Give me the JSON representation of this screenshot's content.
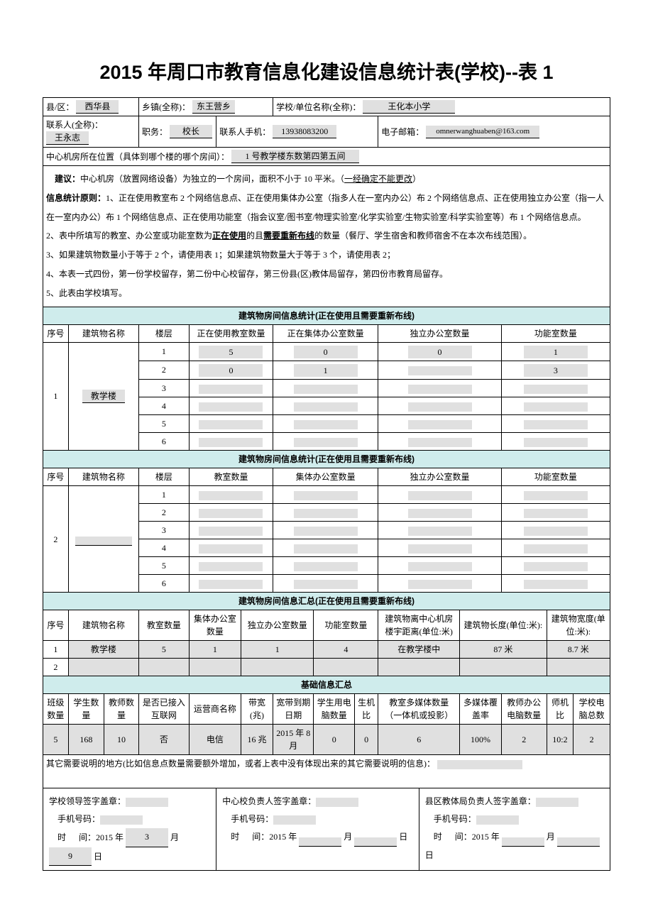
{
  "title": "2015 年周口市教育信息化建设信息统计表(学校)--表 1",
  "header": {
    "county_label": "县/区：",
    "county": "西华县",
    "township_label": "乡镇(全称)：",
    "township": "东王营乡",
    "school_label": "学校/单位名称(全称)：",
    "school": "王化本小学",
    "contact_label": "联系人(全称)：",
    "contact": "王永志",
    "position_label": "职务：",
    "position": "校长",
    "phone_label": "联系人手机：",
    "phone": "13938083200",
    "email_label": "电子邮箱：",
    "email": "omnerwanghuaben@163.com",
    "server_room_label": "中心机房所在位置（具体到哪个楼的哪个房间）：",
    "server_room": "1 号教学楼东数第四第五间"
  },
  "suggest": {
    "label": "建议：",
    "text": "中心机房（放置网络设备）为独立的一个房间，面积不小于 10 平米。（",
    "fixed": "一经确定不能更改",
    "tail": "）"
  },
  "rules": {
    "r1a": "信息统计原则：",
    "r1b": "1、正在使用教室布 2 个网络信息点、正在使用集体办公室（指多人在一室内办公）布 2 个网络信息点、正在使用独立办公室（指一人",
    "r1c": "在一室内办公）布 1 个网络信息点、正在使用功能室（指会议室/图书室/物理实验室/化学实验室/生物实验室/科学实验室等）布 1 个网络信息点。",
    "r2a": "2、表中所填写的教室、办公室或功能室数为",
    "r2b": "正在使用",
    "r2c": "的且",
    "r2d": "需要重新布线",
    "r2e": "的数量（餐厅、学生宿舍和教师宿舍不在本次布线范围）。",
    "r3": "3、如果建筑物数量小于等于 2 个，请使用表 1；如果建筑物数量大于等于 3 个，请使用表 2；",
    "r4": "4、本表一式四份，第一份学校留存，第二份中心校留存，第三份县(区)教体局留存，第四份市教育局留存。",
    "r5": "5、此表由学校填写。"
  },
  "bldg1": {
    "section": "建筑物房间信息统计(正在使用且需要重新布线)",
    "cols": {
      "seq": "序号",
      "name": "建筑物名称",
      "floor": "楼层",
      "classrooms": "正在使用教室数量",
      "group": "正在集体办公室数量",
      "indep": "独立办公室数量",
      "func": "功能室数量"
    },
    "rows": [
      {
        "seq": "1",
        "name": "教学楼",
        "floors": [
          {
            "f": "1",
            "c": "5",
            "g": "0",
            "i": "0",
            "fn": "1"
          },
          {
            "f": "2",
            "c": "0",
            "g": "1",
            "i": "",
            "fn": "3"
          },
          {
            "f": "3",
            "c": "",
            "g": "",
            "i": "",
            "fn": ""
          },
          {
            "f": "4",
            "c": "",
            "g": "",
            "i": "",
            "fn": ""
          },
          {
            "f": "5",
            "c": "",
            "g": "",
            "i": "",
            "fn": ""
          },
          {
            "f": "6",
            "c": "",
            "g": "",
            "i": "",
            "fn": ""
          }
        ]
      }
    ]
  },
  "bldg2": {
    "section": "建筑物房间信息统计(正在使用且需要重新布线)",
    "cols": {
      "seq": "序号",
      "name": "建筑物名称",
      "floor": "楼层",
      "classrooms": "教室数量",
      "group": "集体办公室数量",
      "indep": "独立办公室数量",
      "func": "功能室数量"
    },
    "rows": [
      {
        "seq": "2",
        "name": "",
        "floors": [
          {
            "f": "1",
            "c": "",
            "g": "",
            "i": "",
            "fn": ""
          },
          {
            "f": "2",
            "c": "",
            "g": "",
            "i": "",
            "fn": ""
          },
          {
            "f": "3",
            "c": "",
            "g": "",
            "i": "",
            "fn": ""
          },
          {
            "f": "4",
            "c": "",
            "g": "",
            "i": "",
            "fn": ""
          },
          {
            "f": "5",
            "c": "",
            "g": "",
            "i": "",
            "fn": ""
          },
          {
            "f": "6",
            "c": "",
            "g": "",
            "i": "",
            "fn": ""
          }
        ]
      }
    ]
  },
  "summary": {
    "section": "建筑物房间信息汇总(正在使用且需要重新布线)",
    "cols": {
      "seq": "序号",
      "name": "建筑物名称",
      "c": "教室数量",
      "g": "集体办公室数量",
      "i": "独立办公室数量",
      "fn": "功能室数量",
      "dist": "建筑物离中心机房楼宇距离(单位:米)",
      "len": "建筑物长度(单位:米):",
      "wid": "建筑物宽度(单位:米):"
    },
    "rows": [
      {
        "seq": "1",
        "name": "教学楼",
        "c": "5",
        "g": "1",
        "i": "1",
        "fn": "4",
        "dist": "在教学楼中",
        "len": "87 米",
        "wid": "8.7 米"
      },
      {
        "seq": "2",
        "name": "",
        "c": "",
        "g": "",
        "i": "",
        "fn": "",
        "dist": "",
        "len": "",
        "wid": ""
      }
    ]
  },
  "basic": {
    "section": "基础信息汇总",
    "cols": {
      "cls": "班级数量",
      "stu": "学生数量",
      "tch": "教师数量",
      "net": "是否已接入互联网",
      "isp": "运营商名称",
      "bw": "带宽(兆)",
      "exp": "宽带到期日期",
      "stupc": "学生用电脑数量",
      "ratio1": "生机比",
      "mm": "教室多媒体数量（一体机或投影）",
      "cov": "多媒体覆盖率",
      "tchpc": "教师办公电脑数量",
      "ratio2": "师机比",
      "total": "学校电脑总数"
    },
    "row": {
      "cls": "5",
      "stu": "168",
      "tch": "10",
      "net": "否",
      "isp": "电信",
      "bw": "16 兆",
      "exp": "2015 年 8 月",
      "stupc": "0",
      "ratio1": "0",
      "mm": "6",
      "cov": "100%",
      "tchpc": "2",
      "ratio2": "10:2",
      "total": "2"
    }
  },
  "notes": {
    "label": "其它需要说明的地方(比如信息点数量需要额外增加，或者上表中没有体现出来的其它需要说明的信息)：",
    "value": ""
  },
  "sig": {
    "school": {
      "l1": "学校领导签字盖章：",
      "l2": "手机号码：",
      "l3a": "时",
      "l3b": "间：2015 年",
      "m": "3",
      "l3c": "月",
      "d": "9",
      "l3d": "日"
    },
    "center": {
      "l1": "中心校负责人签字盖章：",
      "l2": "手机号码：",
      "l3a": "时",
      "l3b": "间：2015 年",
      "m": "",
      "l3c": "月",
      "d": "",
      "l3d": "日"
    },
    "county": {
      "l1": "县区教体局负责人签字盖章：",
      "l2": "手机号码：",
      "l3a": "时",
      "l3b": "间：2015 年",
      "m": "",
      "l3c": "月",
      "d": "",
      "l3d": "日"
    }
  }
}
